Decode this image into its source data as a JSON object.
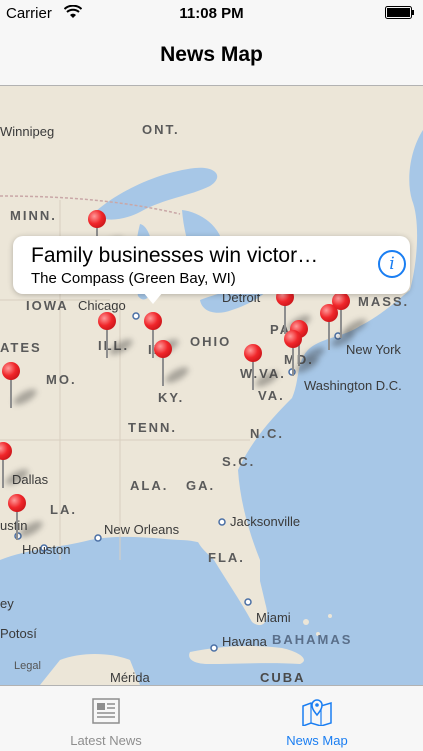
{
  "status_bar": {
    "carrier": "Carrier",
    "time": "11:08 PM"
  },
  "nav": {
    "title": "News Map"
  },
  "map": {
    "region_labels": [
      "ONT.",
      "MINN.",
      "IOWA",
      "ILL.",
      "IN",
      "OHIO",
      "PA.",
      "MASS.",
      "MD.",
      "W.VA.",
      "VA.",
      "KY.",
      "MO.",
      "TENN.",
      "N.C.",
      "S.C.",
      "ALA.",
      "GA.",
      "LA.",
      "FLA.",
      "ATES"
    ],
    "cities": [
      "Winnipeg",
      "Chicago",
      "Detroit",
      "New York",
      "Washington D.C.",
      "Dallas",
      "New Orleans",
      "Houston",
      "Jacksonville",
      "Miami",
      "Havana",
      "Mérida",
      "Potosí",
      "ustin",
      "ey"
    ],
    "sea_labels": [
      "BAHAMAS",
      "CUBA"
    ],
    "legal": "Legal"
  },
  "callout": {
    "title": "Family businesses win victor…",
    "subtitle": "The Compass (Green Bay, WI)",
    "info_label": "i"
  },
  "tabs": [
    {
      "label": "Latest News",
      "icon": "newspaper-icon",
      "active": false
    },
    {
      "label": "News Map",
      "icon": "map-pin-icon",
      "active": true
    }
  ],
  "colors": {
    "accent": "#1a7ef2",
    "pin": "#f0262a",
    "land": "#ece6d8",
    "water": "#a7c7e7"
  }
}
